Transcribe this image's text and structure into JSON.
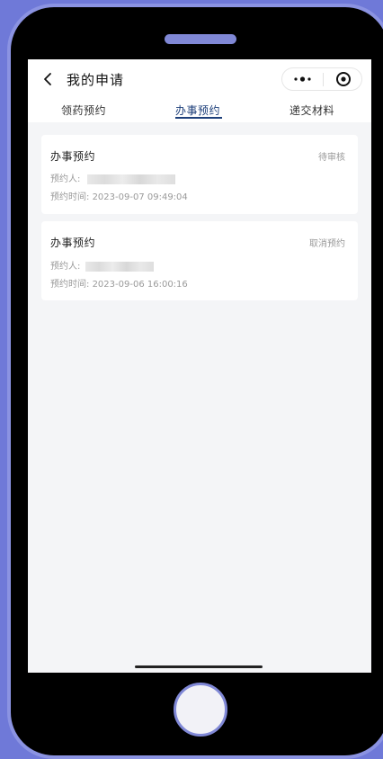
{
  "nav": {
    "title": "我的申请"
  },
  "tabs": [
    {
      "label": "领药预约",
      "active": false
    },
    {
      "label": "办事预约",
      "active": true
    },
    {
      "label": "递交材料",
      "active": false
    }
  ],
  "records": [
    {
      "title": "办事预约",
      "status": "待审核",
      "person_label": "预约人:",
      "time_label": "预约时间:",
      "time_value": "2023-09-07 09:49:04"
    },
    {
      "title": "办事预约",
      "status": "取消预约",
      "person_label": "预约人:",
      "time_label": "预约时间:",
      "time_value": "2023-09-06 16:00:16"
    }
  ],
  "colors": {
    "accent": "#1d3f7a",
    "frame": "#6f79d8",
    "screen_bg": "#f4f5f7"
  }
}
